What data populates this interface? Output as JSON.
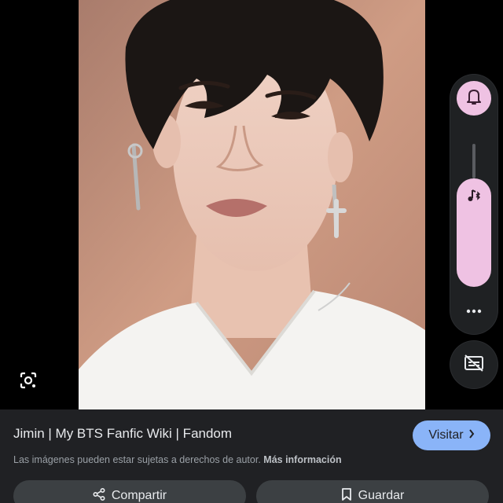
{
  "image": {
    "subject_icon": "photo"
  },
  "lens": {
    "icon": "lens-icon"
  },
  "volume": {
    "bell_icon": "bell-icon",
    "music_icon": "music-note-icon",
    "more_icon": "more-dots-icon",
    "level": 0.76,
    "accent_color": "#efc2e3"
  },
  "captions": {
    "icon": "captions-off-icon"
  },
  "result": {
    "title": "Jimin | My BTS Fanfic Wiki | Fandom",
    "visit_label": "Visitar",
    "copyright_text": "Las imágenes pueden estar sujetas a derechos de autor.",
    "more_info_label": "Más información",
    "share_label": "Compartir",
    "save_label": "Guardar"
  },
  "colors": {
    "background": "#000000",
    "sheet": "#202124",
    "visit_button": "#8ab4f8",
    "action_button": "#3c4043"
  }
}
